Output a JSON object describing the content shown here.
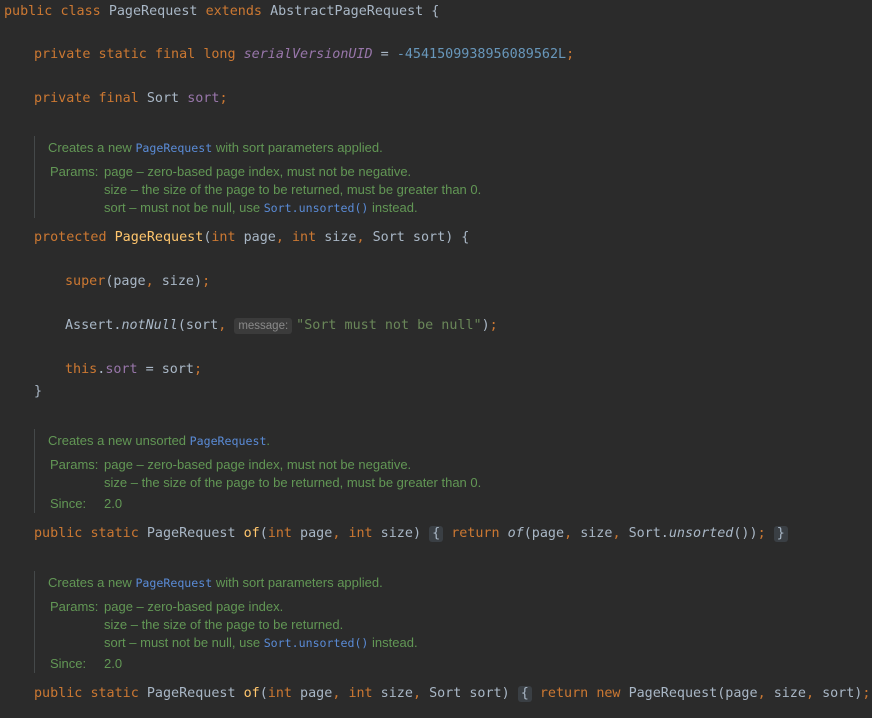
{
  "editor": {
    "lines": {
      "class_decl": {
        "kw_public": "public",
        "kw_class": "class",
        "class_name": "PageRequest",
        "kw_extends": "extends",
        "super_class": "AbstractPageRequest",
        "brace": " {"
      },
      "serial_field": {
        "kw_private": "private",
        "kw_static": "static",
        "kw_final": "final",
        "kw_long": "long",
        "field_name": "serialVersionUID",
        "assign": " = ",
        "value": "-4541509938956089562L",
        "semi": ";"
      },
      "sort_field": {
        "kw_private": "private",
        "kw_final": "final",
        "type": "Sort",
        "field_name": "sort",
        "semi": ";"
      },
      "ctor_decl": {
        "kw_protected": "protected",
        "name": "PageRequest",
        "open": "(",
        "kw_int1": "int",
        "p1": " page",
        "comma1": ", ",
        "kw_int2": "int",
        "p2": " size",
        "comma2": ", ",
        "p3": "Sort sort",
        "close": ") {"
      },
      "super_call": {
        "kw_super": "super",
        "args": "(page",
        "comma": ", ",
        "args2": "size)",
        "semi": ";"
      },
      "assert_call": {
        "prefix": "Assert.",
        "method": "notNull",
        "args": "(sort",
        "comma": ", ",
        "hint": "message:",
        "string": "\"Sort must not be null\"",
        "close": ")",
        "semi": ";"
      },
      "this_assign": {
        "kw_this": "this",
        "dot": ".",
        "field": "sort",
        "rest": " = sort",
        "semi": ";"
      },
      "close_brace": "}",
      "of2_decl": {
        "kw_public": "public",
        "kw_static": "static",
        "type": "PageRequest",
        "name": "of",
        "open": "(",
        "kw_int1": "int",
        "p1": " page",
        "comma1": ", ",
        "kw_int2": "int",
        "p2": " size",
        "close": ") ",
        "fold_open": "{",
        "kw_return": "return",
        "call": "of",
        "args": "(page",
        "comma1b": ", ",
        "args2": "size",
        "comma2b": ", ",
        "args3": "Sort.",
        "unsorted": "unsorted",
        "args4": "())",
        "semi": ";",
        "fold_close": "}"
      },
      "of3_decl": {
        "kw_public": "public",
        "kw_static": "static",
        "type": "PageRequest",
        "name": "of",
        "open": "(",
        "kw_int1": "int",
        "p1": " page",
        "comma1": ", ",
        "kw_int2": "int",
        "p2": " size",
        "comma2": ", ",
        "p3": "Sort sort",
        "close": ") ",
        "fold_open": "{",
        "kw_return": "return",
        "kw_new": "new",
        "ctor": "PageRequest",
        "args": "(page",
        "comma1b": ", ",
        "args2": "size",
        "comma2b": ", ",
        "args3": "sort)",
        "semi": ";",
        "fold_close": "}"
      }
    },
    "docs": {
      "ctor": {
        "summary_pre": "Creates a new ",
        "summary_link": "PageRequest",
        "summary_post": " with sort parameters applied.",
        "params_label": "Params:",
        "p_page": "page – zero-based page index, must not be negative.",
        "p_size": "size – the size of the page to be returned, must be greater than 0.",
        "p_sort_pre": "sort – must not be null, use ",
        "p_sort_link": "Sort.unsorted()",
        "p_sort_post": " instead."
      },
      "of2": {
        "summary_pre": "Creates a new unsorted ",
        "summary_link": "PageRequest",
        "summary_post": ".",
        "params_label": "Params:",
        "p_page": "page – zero-based page index, must not be negative.",
        "p_size": "size – the size of the page to be returned, must be greater than 0.",
        "since_label": "Since:",
        "since_value": "2.0"
      },
      "of3": {
        "summary_pre": "Creates a new ",
        "summary_link": "PageRequest",
        "summary_post": " with sort parameters applied.",
        "params_label": "Params:",
        "p_page": "page – zero-based page index.",
        "p_size": "size – the size of the page to be returned.",
        "p_sort_pre": "sort – must not be null, use ",
        "p_sort_link": "Sort.unsorted()",
        "p_sort_post": " instead.",
        "since_label": "Since:",
        "since_value": "2.0"
      }
    }
  },
  "colors": {
    "background": "#2b2b2b",
    "keyword": "#cc7832",
    "default_text": "#a9b7c6",
    "method": "#ffc66d",
    "field": "#9876aa",
    "number": "#6897bb",
    "string": "#6a8759",
    "doc_text": "#629755",
    "doc_link": "#5a8bd6"
  }
}
